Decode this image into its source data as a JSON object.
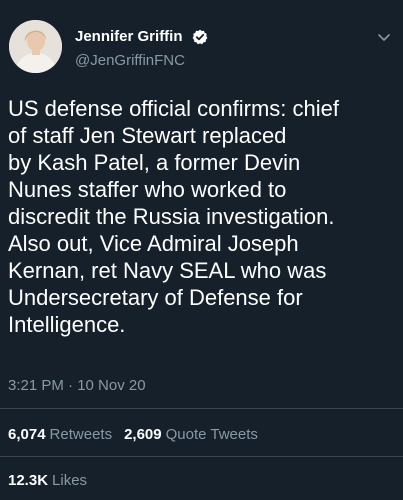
{
  "colors": {
    "background": "#15202b",
    "text": "#ffffff",
    "secondary": "#8899a6",
    "divider": "#38444d",
    "verified": "#ffffff"
  },
  "author": {
    "display_name": "Jennifer Griffin",
    "handle": "@JenGriffinFNC",
    "verified_icon": "verified-badge-icon",
    "menu_icon": "chevron-down-icon"
  },
  "tweet": {
    "text": "US defense official confirms: chief\nof staff Jen Stewart replaced\nby Kash Patel, a former Devin\nNunes staffer who worked to\ndiscredit the Russia investigation.\nAlso out, Vice Admiral Joseph\nKernan, ret Navy SEAL who was\nUndersecretary of Defense for\nIntelligence.",
    "timestamp": "3:21 PM · 10 Nov 20"
  },
  "stats": {
    "retweets_count": "6,074",
    "retweets_label": "Retweets",
    "quotes_count": "2,609",
    "quotes_label": "Quote Tweets",
    "likes_count": "12.3K",
    "likes_label": "Likes"
  }
}
